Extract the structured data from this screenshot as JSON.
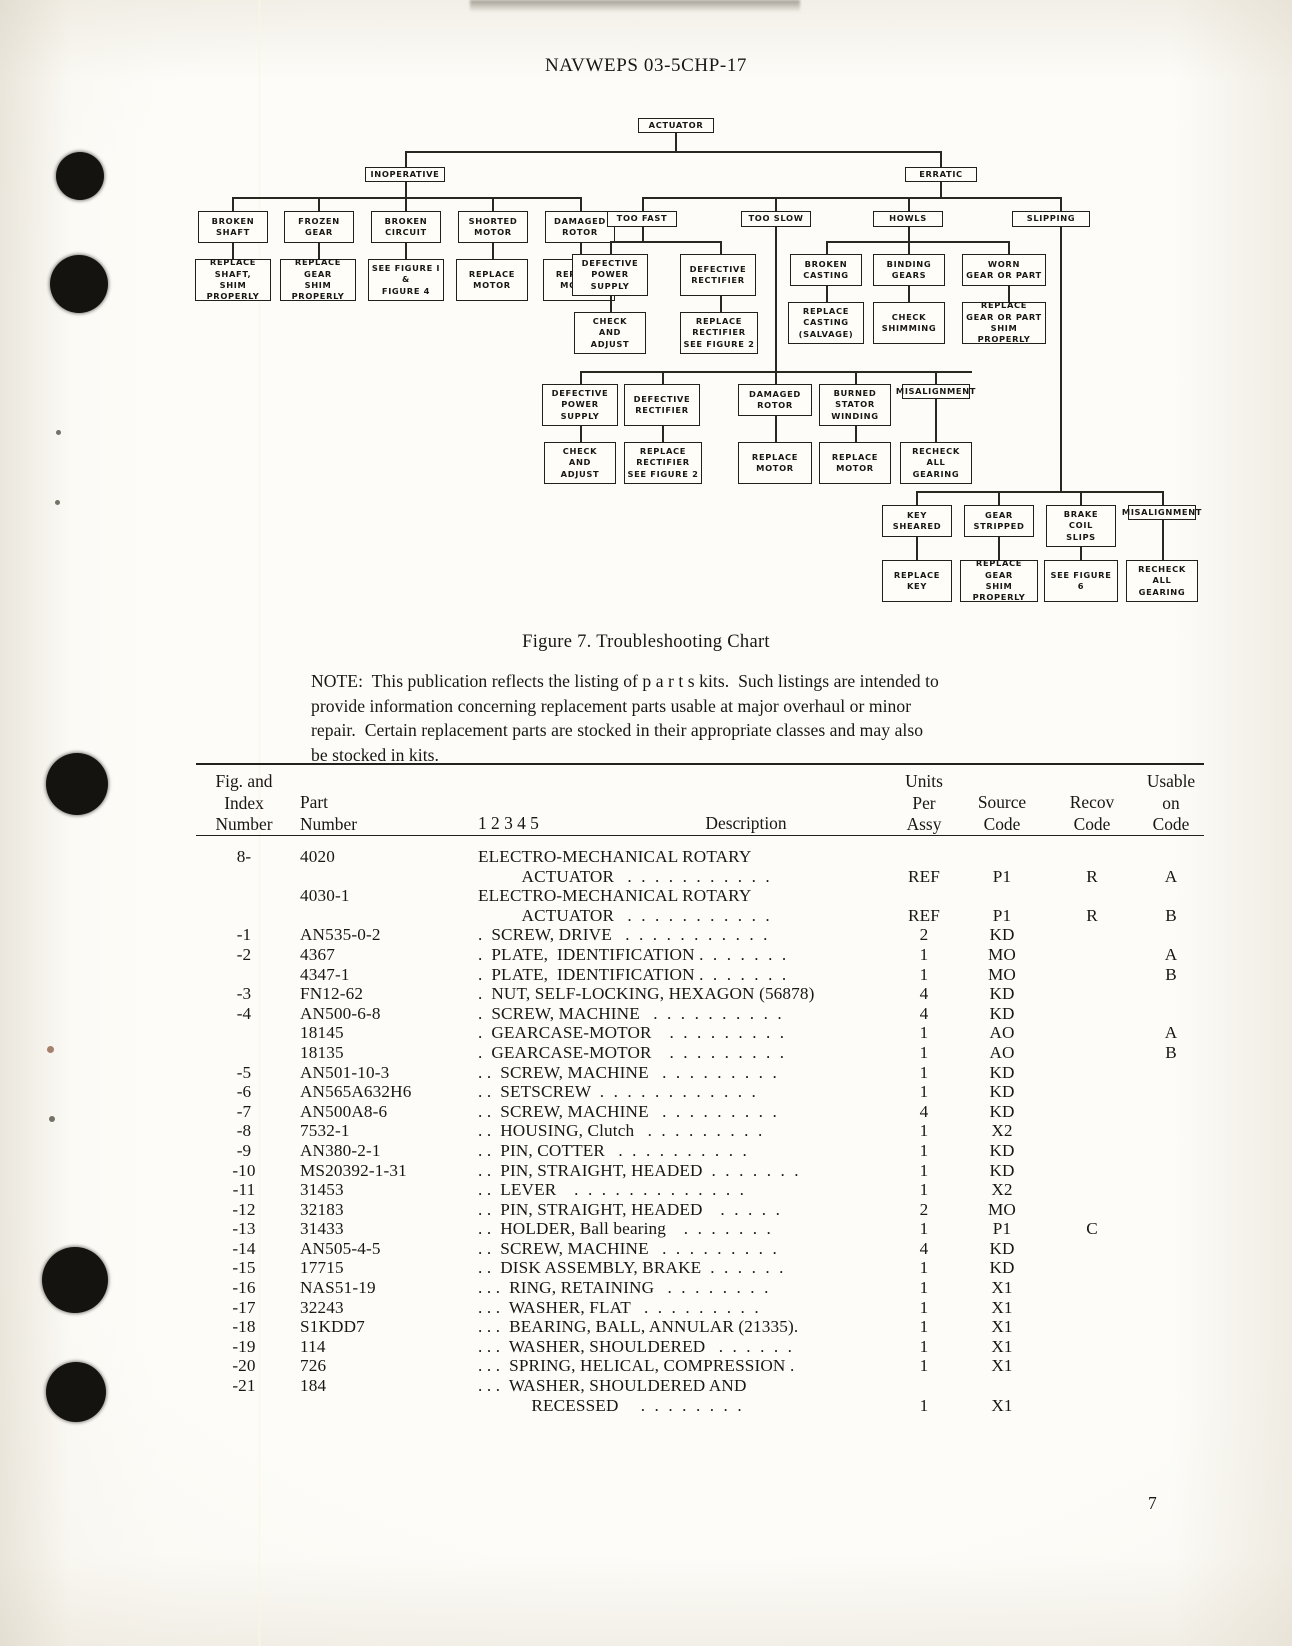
{
  "document": {
    "header": "NAVWEPS 03-5CHP-17",
    "page_number": "7"
  },
  "figure": {
    "caption": "Figure 7.  Troubleshooting Chart",
    "nodes": {
      "actuator": "ACTUATOR",
      "inoperative": "INOPERATIVE",
      "erratic": "ERRATIC",
      "broken_shaft": "BROKEN\nSHAFT",
      "frozen_gear": "FROZEN\nGEAR",
      "broken_circuit": "BROKEN\nCIRCUIT",
      "shorted_motor": "SHORTED\nMOTOR",
      "damaged_rotor": "DAMAGED\nROTOR",
      "replace_shaft": "REPLACE\nSHAFT,\nSHIM PROPERLY",
      "replace_gear_shim": "REPLACE\nGEAR\nSHIM PROPERLY",
      "see_figure_1_4": "SEE FIGURE I\n&\nFIGURE 4",
      "replace_motor_1": "REPLACE\nMOTOR",
      "replace_motor_2": "REPLACE\nMOTOR",
      "too_fast": "TOO FAST",
      "too_slow": "TOO SLOW",
      "howls": "HOWLS",
      "slipping": "SLIPPING",
      "defective_power_supply_1": "DEFECTIVE\nPOWER\nSUPPLY",
      "defective_rectifier_1": "DEFECTIVE\nRECTIFIER",
      "broken_casting": "BROKEN\nCASTING",
      "binding_gears": "BINDING\nGEARS",
      "worn_gear_or_part": "WORN\nGEAR OR PART",
      "check_and_adjust_1": "CHECK\nAND\nADJUST",
      "replace_rectifier_1": "REPLACE\nRECTIFIER\nSEE FIGURE 2",
      "replace_casting": "REPLACE\nCASTING\n(SALVAGE)",
      "check_shimming": "CHECK\nSHIMMING",
      "replace_gear_or_part": "REPLACE\nGEAR OR PART\nSHIM PROPERLY",
      "defective_power_supply_2": "DEFECTIVE\nPOWER\nSUPPLY",
      "defective_rectifier_2": "DEFECTIVE\nRECTIFIER",
      "damaged_rotor_2": "DAMAGED\nROTOR",
      "burned_stator_winding": "BURNED\nSTATOR\nWINDING",
      "misalignment_1": "MISALIGNMENT",
      "check_and_adjust_2": "CHECK\nAND\nADJUST",
      "replace_rectifier_2": "REPLACE\nRECTIFIER\nSEE FIGURE 2",
      "replace_motor_3": "REPLACE\nMOTOR",
      "replace_motor_4": "REPLACE\nMOTOR",
      "recheck_all_gearing_1": "RECHECK\nALL\nGEARING",
      "key_sheared": "KEY\nSHEARED",
      "gear_stripped": "GEAR\nSTRIPPED",
      "brake_coil_slips": "BRAKE\nCOIL\nSLIPS",
      "misalignment_2": "MISALIGNMENT",
      "replace_key": "REPLACE\nKEY",
      "replace_gear_shim_2": "REPLACE\nGEAR\nSHIM PROPERLY",
      "see_figure_6": "SEE FIGURE 6",
      "recheck_all_gearing_2": "RECHECK\nALL\nGEARING"
    }
  },
  "note": {
    "line1": "NOTE:  This publication reflects the listing of p a r t s kits.  Such listings are intended to",
    "line2": "provide information concerning replacement parts usable at major overhaul or minor",
    "line3": "repair.  Certain replacement parts are stocked in their appropriate classes and may also",
    "line4": "be stocked in kits."
  },
  "table": {
    "headers": {
      "index": "Fig. and\nIndex\nNumber",
      "part": "Part\nNumber",
      "levels": "1  2  3  4  5",
      "description": "Description",
      "units": "Units\nPer\nAssy",
      "source": "Source\nCode",
      "recov": "Recov\nCode",
      "usable": "Usable\non\nCode"
    },
    "rows": [
      {
        "index": "8-",
        "part": "4020",
        "desc": "ELECTRO-MECHANICAL ROTARY",
        "dots": "",
        "assy": "",
        "source": "",
        "recov": "",
        "usable": ""
      },
      {
        "index": "",
        "part": "",
        "desc": "          ACTUATOR   ",
        "dots": ". . . . . . . . . . .",
        "assy": "REF",
        "source": "P1",
        "recov": "R",
        "usable": "A"
      },
      {
        "index": "",
        "part": "4030-1",
        "desc": "ELECTRO-MECHANICAL ROTARY",
        "dots": "",
        "assy": "",
        "source": "",
        "recov": "",
        "usable": ""
      },
      {
        "index": "",
        "part": "",
        "desc": "          ACTUATOR   ",
        "dots": ". . . . . . . . . . .",
        "assy": "REF",
        "source": "P1",
        "recov": "R",
        "usable": "B"
      },
      {
        "index": "-1",
        "part": "AN535-0-2",
        "desc": ".  SCREW, DRIVE   ",
        "dots": ". . . . . . . . . . .",
        "assy": "2",
        "source": "KD",
        "recov": "",
        "usable": ""
      },
      {
        "index": "-2",
        "part": "4367",
        "desc": ".  PLATE,  IDENTIFICATION ",
        "dots": ". . . . . . .",
        "assy": "1",
        "source": "MO",
        "recov": "",
        "usable": "A"
      },
      {
        "index": "",
        "part": "4347-1",
        "desc": ".  PLATE,  IDENTIFICATION ",
        "dots": ". . . . . . .",
        "assy": "1",
        "source": "MO",
        "recov": "",
        "usable": "B"
      },
      {
        "index": "-3",
        "part": "FN12-62",
        "desc": ".  NUT, SELF-LOCKING, HEXAGON (56878)",
        "dots": "",
        "assy": "4",
        "source": "KD",
        "recov": "",
        "usable": ""
      },
      {
        "index": "-4",
        "part": "AN500-6-8",
        "desc": ".  SCREW, MACHINE   ",
        "dots": ". . . . . . . . . .",
        "assy": "4",
        "source": "KD",
        "recov": "",
        "usable": ""
      },
      {
        "index": "",
        "part": "18145",
        "desc": ".  GEARCASE-MOTOR    ",
        "dots": ". . . . . . . . .",
        "assy": "1",
        "source": "AO",
        "recov": "",
        "usable": "A"
      },
      {
        "index": "",
        "part": "18135",
        "desc": ".  GEARCASE-MOTOR    ",
        "dots": ". . . . . . . . .",
        "assy": "1",
        "source": "AO",
        "recov": "",
        "usable": "B"
      },
      {
        "index": "-5",
        "part": "AN501-10-3",
        "desc": ". .  SCREW, MACHINE   ",
        "dots": ". . . . . . . . .",
        "assy": "1",
        "source": "KD",
        "recov": "",
        "usable": ""
      },
      {
        "index": "-6",
        "part": "AN565A632H6",
        "desc": ". .  SETSCREW  ",
        "dots": ". . . . . . . . . . . .",
        "assy": "1",
        "source": "KD",
        "recov": "",
        "usable": ""
      },
      {
        "index": "-7",
        "part": "AN500A8-6",
        "desc": ". .  SCREW, MACHINE   ",
        "dots": ". . . . . . . . .",
        "assy": "4",
        "source": "KD",
        "recov": "",
        "usable": ""
      },
      {
        "index": "-8",
        "part": "7532-1",
        "desc": ". .  HOUSING, Clutch   ",
        "dots": ". . . . . . . . .",
        "assy": "1",
        "source": "X2",
        "recov": "",
        "usable": ""
      },
      {
        "index": "-9",
        "part": "AN380-2-1",
        "desc": ". .  PIN, COTTER   ",
        "dots": ". . . . . . . . . .",
        "assy": "1",
        "source": "KD",
        "recov": "",
        "usable": ""
      },
      {
        "index": "-10",
        "part": "MS20392-1-31",
        "desc": ". .  PIN, STRAIGHT, HEADED  ",
        "dots": ". . . . . . .",
        "assy": "1",
        "source": "KD",
        "recov": "",
        "usable": ""
      },
      {
        "index": "-11",
        "part": "31453",
        "desc": ". .  LEVER    ",
        "dots": ". . . . . . . . . . . . .",
        "assy": "1",
        "source": "X2",
        "recov": "",
        "usable": ""
      },
      {
        "index": "-12",
        "part": "32183",
        "desc": ". .  PIN, STRAIGHT, HEADED    ",
        "dots": ". . . . .",
        "assy": "2",
        "source": "MO",
        "recov": "",
        "usable": ""
      },
      {
        "index": "-13",
        "part": "31433",
        "desc": ". .  HOLDER, Ball bearing    ",
        "dots": ". . . . . . .",
        "assy": "1",
        "source": "P1",
        "recov": "C",
        "usable": ""
      },
      {
        "index": "-14",
        "part": "AN505-4-5",
        "desc": ". .  SCREW, MACHINE   ",
        "dots": ". . . . . . . . .",
        "assy": "4",
        "source": "KD",
        "recov": "",
        "usable": ""
      },
      {
        "index": "-15",
        "part": "17715",
        "desc": ". .  DISK ASSEMBLY, BRAKE  ",
        "dots": ". . . . . .",
        "assy": "1",
        "source": "KD",
        "recov": "",
        "usable": ""
      },
      {
        "index": "-16",
        "part": "NAS51-19",
        "desc": ". . .  RING, RETAINING   ",
        "dots": ". . . . . . . .",
        "assy": "1",
        "source": "X1",
        "recov": "",
        "usable": ""
      },
      {
        "index": "-17",
        "part": "32243",
        "desc": ". . .  WASHER, FLAT   ",
        "dots": ". . . . . . . . .",
        "assy": "1",
        "source": "X1",
        "recov": "",
        "usable": ""
      },
      {
        "index": "-18",
        "part": "S1KDD7",
        "desc": ". . .  BEARING, BALL, ANNULAR (21335).",
        "dots": "",
        "assy": "1",
        "source": "X1",
        "recov": "",
        "usable": ""
      },
      {
        "index": "-19",
        "part": "114",
        "desc": ". . .  WASHER, SHOULDERED   ",
        "dots": ". . . . . .",
        "assy": "1",
        "source": "X1",
        "recov": "",
        "usable": ""
      },
      {
        "index": "-20",
        "part": "726",
        "desc": ". . .  SPRING, HELICAL, COMPRESSION .",
        "dots": "",
        "assy": "1",
        "source": "X1",
        "recov": "",
        "usable": ""
      },
      {
        "index": "-21",
        "part": "184",
        "desc": ". . .  WASHER, SHOULDERED AND",
        "dots": "",
        "assy": "",
        "source": "",
        "recov": "",
        "usable": ""
      },
      {
        "index": "",
        "part": "",
        "desc": "            RECESSED     ",
        "dots": ". . . . . . . .",
        "assy": "1",
        "source": "X1",
        "recov": "",
        "usable": ""
      }
    ]
  }
}
